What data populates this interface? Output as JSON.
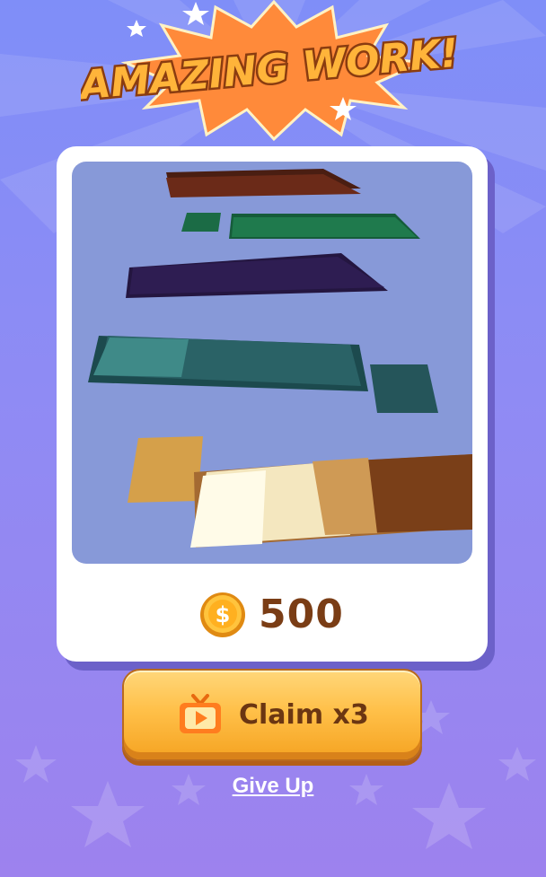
{
  "header": {
    "title": "AMAZING WORK!"
  },
  "reward": {
    "icon": "coin-icon",
    "symbol": "$",
    "amount": "500"
  },
  "claim_button": {
    "icon": "tv-ad-icon",
    "label": "Claim x3"
  },
  "give_up": {
    "label": "Give Up"
  },
  "colors": {
    "background_top": "#7f8ef8",
    "background_bottom": "#9d82ee",
    "card": "#ffffff",
    "button_gold": "#ffc049",
    "text_brown": "#7a3d15",
    "banner_orange": "#ff7a2e"
  }
}
